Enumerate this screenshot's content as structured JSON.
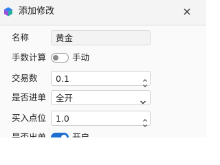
{
  "window": {
    "title": "添加修改",
    "app_icon": "cube-app-icon",
    "close_icon": "close-icon"
  },
  "form": {
    "name": {
      "label": "名称",
      "value": "黄金"
    },
    "manual_calc": {
      "label": "手数计算",
      "toggle_on": false,
      "toggle_text": "手动"
    },
    "lots": {
      "label": "交易数",
      "value": "0.1"
    },
    "entry": {
      "label": "是否进单",
      "selected": "全开"
    },
    "buy_point": {
      "label": "买入点位",
      "value": "1.0"
    },
    "exit": {
      "label": "是否出单",
      "toggle_on": true,
      "toggle_text": "开启"
    }
  },
  "colors": {
    "accent": "#1f6fd1",
    "icon_blue": "#2f80ed",
    "icon_purple": "#9b51e0",
    "icon_teal": "#27ae9f"
  }
}
